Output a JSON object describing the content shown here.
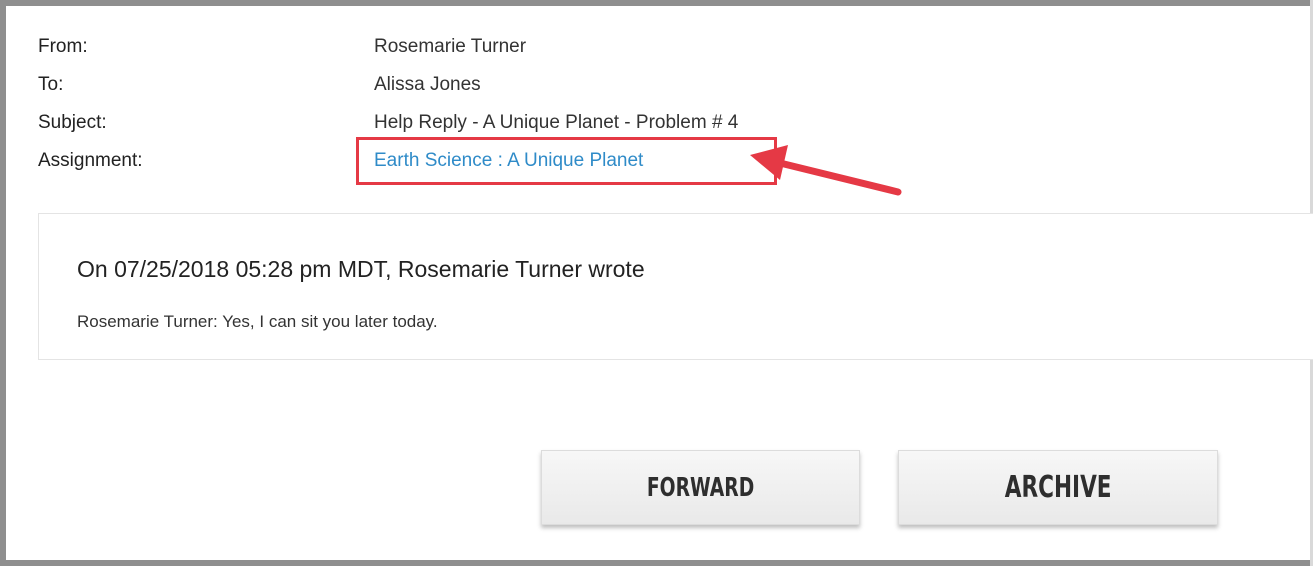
{
  "header": {
    "from_label": "From:",
    "from_value": "Rosemarie Turner",
    "to_label": "To:",
    "to_value": "Alissa Jones",
    "subject_label": "Subject:",
    "subject_value": "Help Reply - A Unique Planet - Problem # 4",
    "assignment_label": "Assignment:",
    "assignment_value": "Earth Science : A Unique Planet"
  },
  "message": {
    "title": "On 07/25/2018 05:28 pm MDT, Rosemarie Turner wrote",
    "body": "Rosemarie Turner: Yes, I can sit you later today."
  },
  "actions": {
    "forward_label": "FORWARD",
    "archive_label": "ARCHIVE"
  },
  "colors": {
    "link": "#2f8bc8",
    "highlight": "#e53945",
    "frame": "#8f8f8f"
  },
  "annotation": {
    "icon": "arrow-left-icon"
  }
}
